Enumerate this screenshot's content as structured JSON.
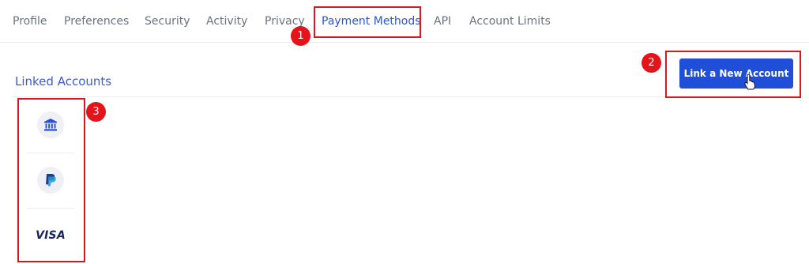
{
  "tabs": [
    {
      "label": "Profile"
    },
    {
      "label": "Preferences"
    },
    {
      "label": "Security"
    },
    {
      "label": "Activity"
    },
    {
      "label": "Privacy"
    },
    {
      "label": "Payment Methods",
      "active": true
    },
    {
      "label": "API"
    },
    {
      "label": "Account Limits"
    }
  ],
  "section": {
    "title": "Linked Accounts"
  },
  "actions": {
    "link_account_label": "Link a New Account"
  },
  "payment_methods": [
    {
      "icon": "bank-icon",
      "name": "Bank"
    },
    {
      "icon": "paypal-icon",
      "name": "PayPal"
    },
    {
      "icon": "visa-icon",
      "name": "Visa",
      "text": "VISA"
    }
  ],
  "annotations": [
    {
      "label": "1",
      "target": "tab-payment-methods"
    },
    {
      "label": "2",
      "target": "link-new-account-button"
    },
    {
      "label": "3",
      "target": "linked-accounts-list"
    }
  ],
  "colors": {
    "accent": "#1f4fd8",
    "active_tab": "#2f55d4",
    "annotation": "#e3151a"
  }
}
